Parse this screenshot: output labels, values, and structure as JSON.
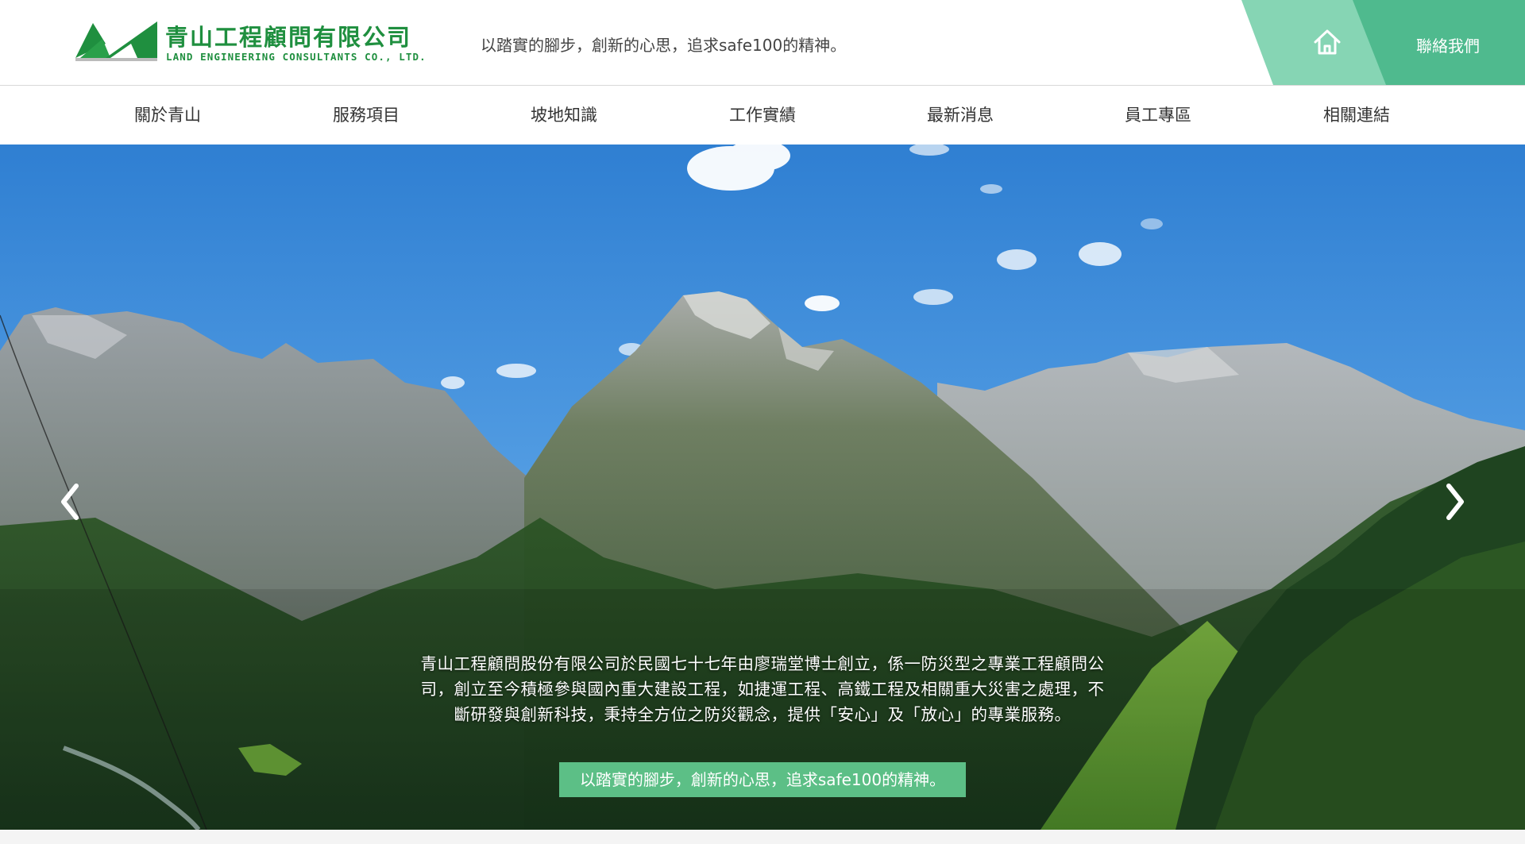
{
  "header": {
    "logo": {
      "name_zh": "青山工程顧問有限公司",
      "name_en": "LAND ENGINEERING CONSULTANTS CO., LTD."
    },
    "slogan": "以踏實的腳步，創新的心思，追求safe100的精神。",
    "home_icon": "home-icon",
    "contact_label": "聯絡我們"
  },
  "nav": {
    "items": [
      "關於青山",
      "服務項目",
      "坡地知識",
      "工作實績",
      "最新消息",
      "員工專區",
      "相關連結"
    ]
  },
  "hero": {
    "intro_lines": [
      "青山工程顧問股份有限公司於民國七十七年由廖瑞堂博士創立，係一防災型之專業工程顧問公",
      "司，創立至今積極參與國內重大建設工程，如捷運工程、高鐵工程及相關重大災害之處理，不",
      "斷研發與創新科技，秉持全方位之防災觀念，提供「安心」及「放心」的專業服務。"
    ],
    "cta_label": "以踏實的腳步，創新的心思，追求safe100的精神。",
    "prev_icon": "chevron-left-icon",
    "next_icon": "chevron-right-icon"
  },
  "colors": {
    "brand_green": "#1f8f3f",
    "home_tab": "#86d5b4",
    "contact_tab": "#4fba8e",
    "cta_bg": "#5cbf86"
  }
}
